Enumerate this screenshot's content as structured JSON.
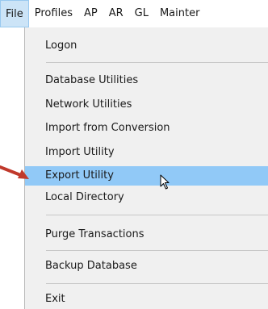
{
  "menubar": {
    "items": [
      {
        "label": "File"
      },
      {
        "label": "Profiles"
      },
      {
        "label": "AP"
      },
      {
        "label": "AR"
      },
      {
        "label": "GL"
      },
      {
        "label": "Mainter"
      }
    ]
  },
  "file_menu": {
    "items": [
      {
        "label": "Logon"
      },
      {
        "label": "Database Utilities"
      },
      {
        "label": "Network Utilities"
      },
      {
        "label": "Import from Conversion"
      },
      {
        "label": "Import Utility"
      },
      {
        "label": "Export Utility",
        "highlighted": true
      },
      {
        "label": "Local Directory"
      },
      {
        "label": "Purge Transactions"
      },
      {
        "label": "Backup Database"
      },
      {
        "label": "Exit"
      }
    ]
  },
  "colors": {
    "highlight": "#91c9f7",
    "active_menu": "#cce4f7",
    "annotation_arrow": "#c0392b"
  },
  "icons": [
    "annotation-arrow-icon",
    "mouse-pointer-icon"
  ]
}
